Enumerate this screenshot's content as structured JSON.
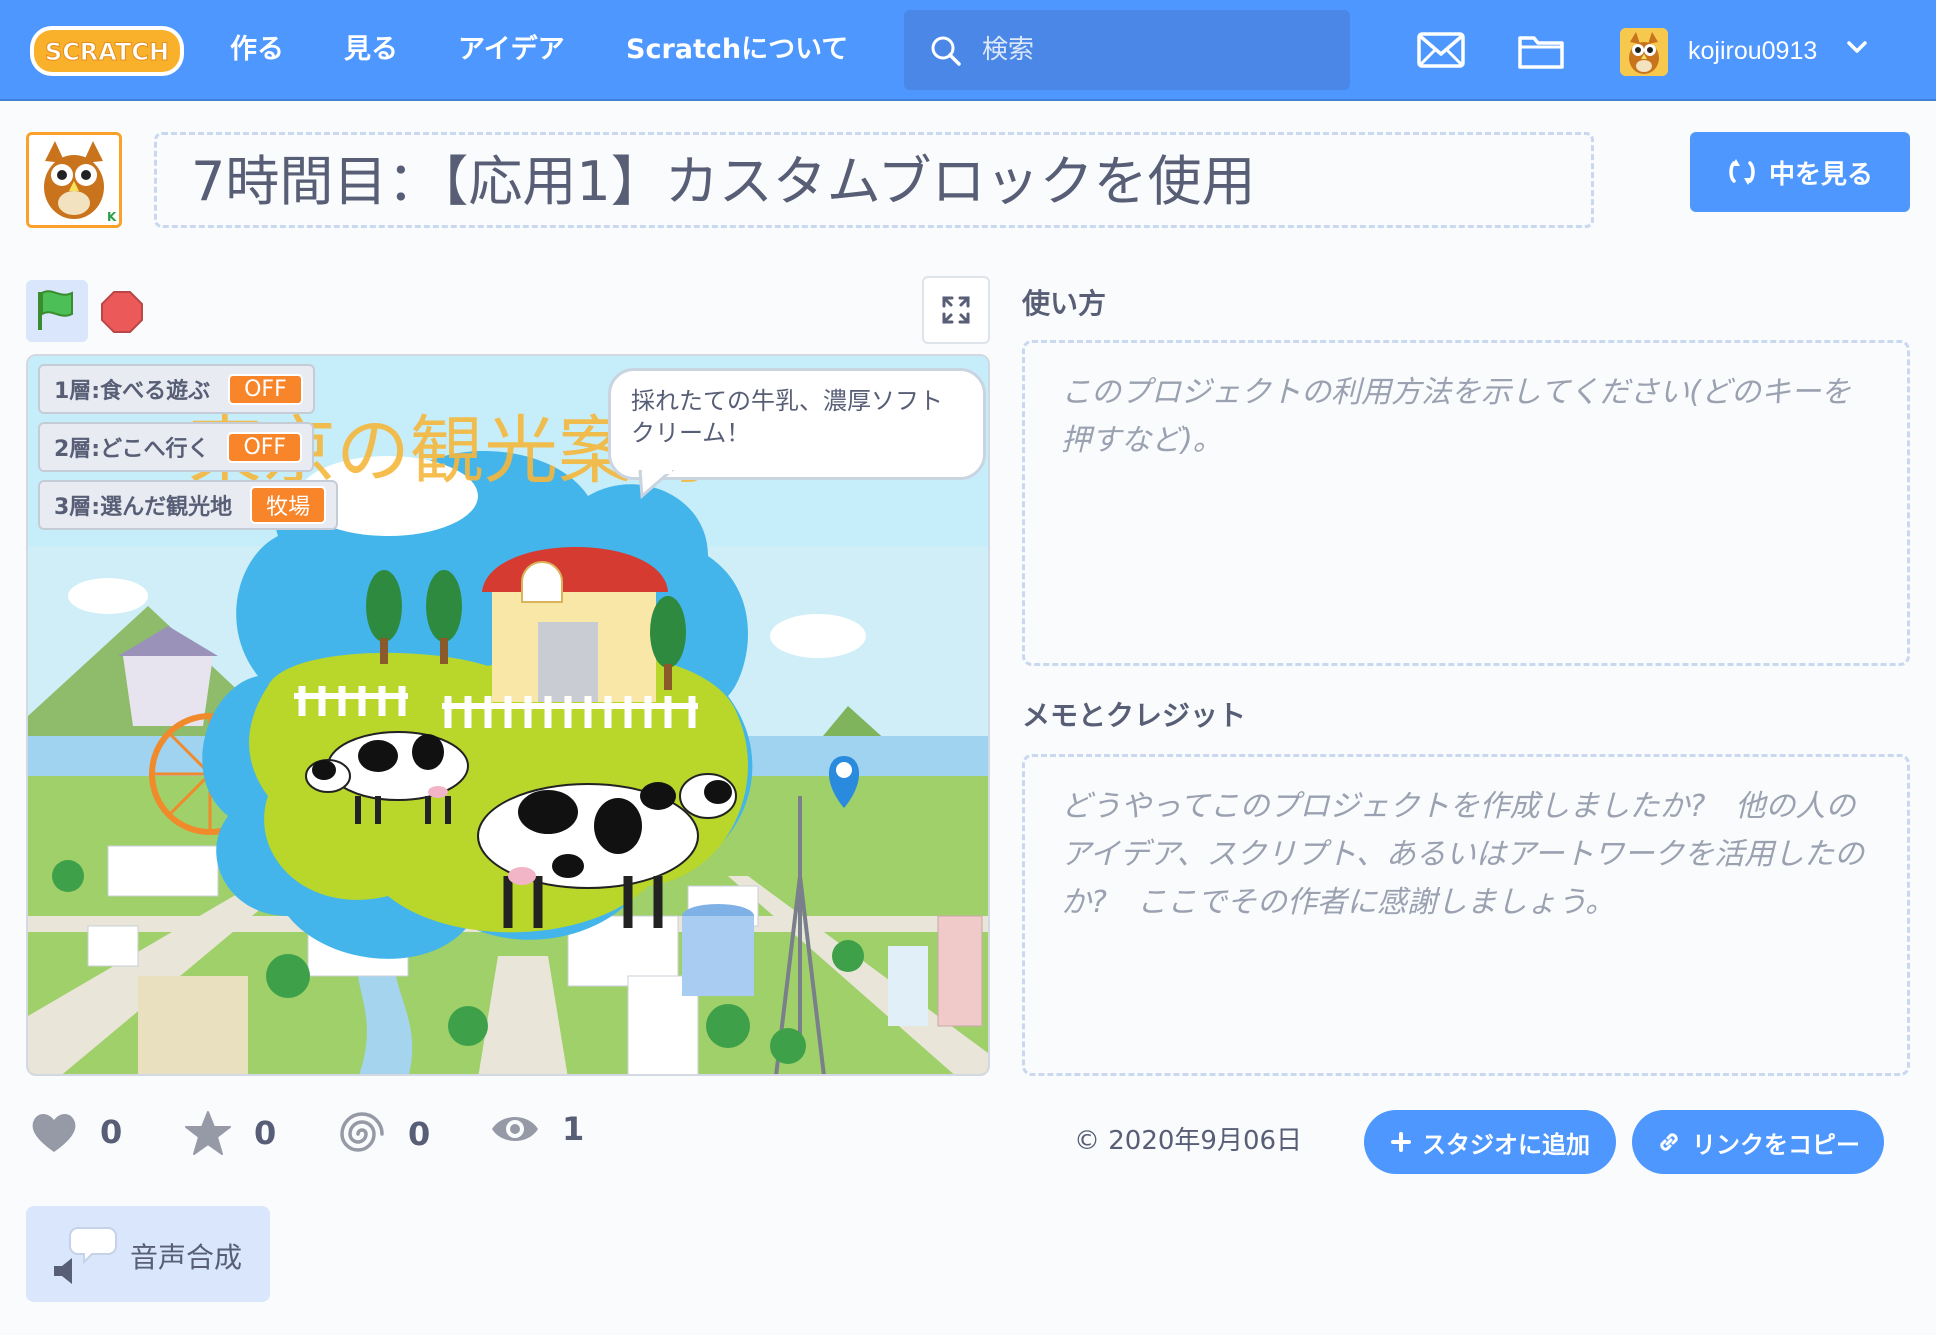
{
  "nav": {
    "logo_text": "SCRATCH",
    "links": [
      "作る",
      "見る",
      "アイデア",
      "Scratchについて"
    ],
    "search_placeholder": "検索",
    "username": "kojirou0913"
  },
  "project": {
    "title": "7時間目：【応用1】カスタムブロックを使用",
    "see_inside_label": "中を見る"
  },
  "stage": {
    "title_text": "東京の観光案内",
    "monitors": [
      {
        "label": "1層:食べる遊ぶ",
        "value": "OFF"
      },
      {
        "label": "2層:どこへ行く",
        "value": "OFF"
      },
      {
        "label": "3層:選んだ観光地",
        "value": "牧場"
      }
    ],
    "speech": "採れたての牛乳、濃厚ソフトクリーム！"
  },
  "instructions": {
    "label": "使い方",
    "placeholder": "このプロジェクトの利用方法を示してください(どのキーを押すなど)。"
  },
  "notes": {
    "label": "メモとクレジット",
    "placeholder": "どうやってこのプロジェクトを作成しましたか?　他の人のアイデア、スクリプト、あるいはアートワークを活用したのか?　ここでその作者に感謝しましょう。"
  },
  "stats": {
    "loves": "0",
    "favorites": "0",
    "remixes": "0",
    "views": "1"
  },
  "date": "© 2020年9月06日",
  "buttons": {
    "add_to_studio": "スタジオに追加",
    "copy_link": "リンクをコピー"
  },
  "extension": {
    "label": "音声合成"
  },
  "colors": {
    "nav_blue": "#4d97ff",
    "monitor_orange": "#f9852a",
    "owl_orange": "#f9a12b"
  }
}
